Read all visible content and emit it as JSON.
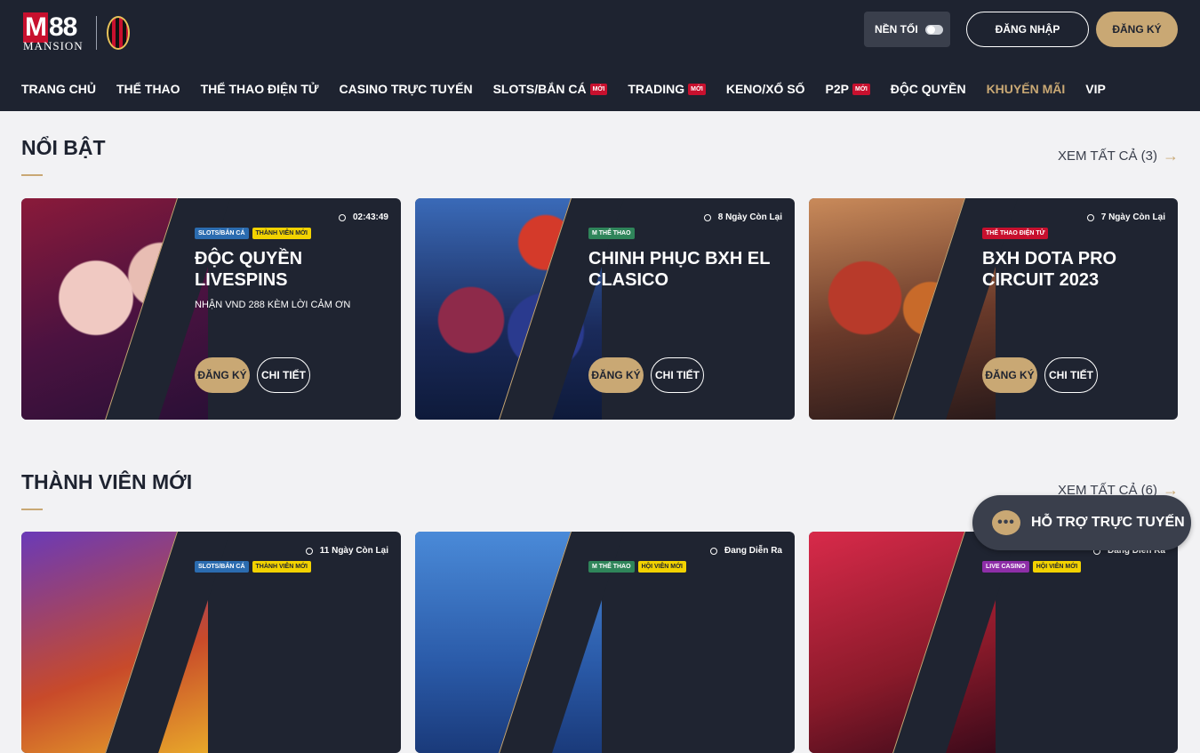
{
  "brand": {
    "logo_text": "88",
    "logo_m": "M",
    "logo_sub": "MANSION"
  },
  "header": {
    "dark_mode_label": "NỀN TỐI",
    "login_label": "ĐĂNG NHẬP",
    "register_label": "ĐĂNG KÝ"
  },
  "nav": {
    "items": [
      {
        "label": "TRANG CHỦ"
      },
      {
        "label": "THỂ THAO"
      },
      {
        "label": "THỂ THAO ĐIỆN TỬ"
      },
      {
        "label": "CASINO TRỰC TUYẾN"
      },
      {
        "label": "SLOTS/BẮN CÁ",
        "badge": "MỚI"
      },
      {
        "label": "TRADING",
        "badge": "MỚI"
      },
      {
        "label": "KENO/XỔ SỐ"
      },
      {
        "label": "P2P",
        "badge": "MỚI"
      },
      {
        "label": "ĐỘC QUYỀN"
      },
      {
        "label": "KHUYẾN MÃI"
      },
      {
        "label": "VIP"
      }
    ]
  },
  "featured": {
    "title": "NỔI BẬT",
    "view_all": "XEM TẤT CẢ (3)",
    "cards": [
      {
        "timer": "02:43:49",
        "tag1": "SLOTS/BẮN CÁ",
        "tag2": "THÀNH VIÊN MỚI",
        "title": "ĐỘC QUYỀN LIVESPINS",
        "sub": "NHẬN VND 288 KÈM LỜI CẢM ƠN",
        "register": "ĐĂNG KÝ",
        "detail": "CHI TIẾT"
      },
      {
        "timer": "8 Ngày Còn Lại",
        "tag1": "M THỂ THAO",
        "title": "CHINH PHỤC BXH EL CLASICO",
        "register": "ĐĂNG KÝ",
        "detail": "CHI TIẾT"
      },
      {
        "timer": "7 Ngày Còn Lại",
        "tag1": "THỂ THAO ĐIỆN TỬ",
        "title": "BXH DOTA PRO CIRCUIT 2023",
        "register": "ĐĂNG KÝ",
        "detail": "CHI TIẾT"
      }
    ]
  },
  "new_members": {
    "title": "THÀNH VIÊN MỚI",
    "view_all": "XEM TẤT CẢ (6)",
    "cards": [
      {
        "timer": "11 Ngày Còn Lại",
        "tag1": "SLOTS/BẮN CÁ",
        "tag2": "THÀNH VIÊN MỚI"
      },
      {
        "timer": "Đang Diễn Ra",
        "tag1": "M THỂ THAO",
        "tag2": "HỘI VIÊN MỚI"
      },
      {
        "timer": "Đang Diễn Ra",
        "tag1": "LIVE CASINO",
        "tag2": "HỘI VIÊN MỚI"
      }
    ]
  },
  "support": {
    "label": "HỖ TRỢ TRỰC TUYẾN"
  }
}
